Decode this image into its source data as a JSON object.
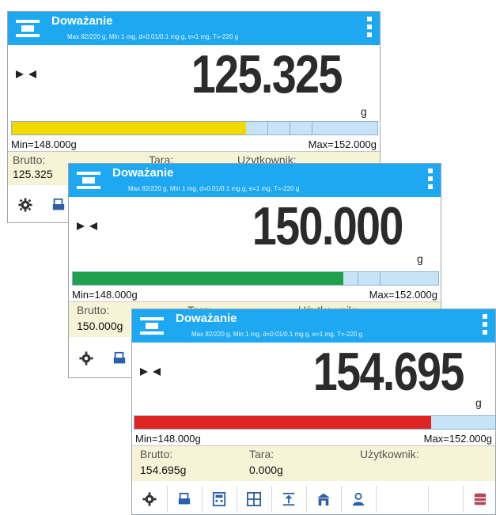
{
  "screens": [
    {
      "title": "Doważanie",
      "info": "Max 82/220 g, Min 1 mg, d=0.01/0.1 mg g, e=1 mg, T=-220 g",
      "reading": "125.325",
      "unit": "g",
      "bar": {
        "fill_fraction": 0.64,
        "fill_color": "#f2d900"
      },
      "min_label": "Min=148.000g",
      "max_label": "Max=152.000g",
      "gross_label": "Brutto:",
      "gross_value": "125.325",
      "tare_label": "Tara:",
      "user_label": "Użytkownik:"
    },
    {
      "title": "Doważanie",
      "info": "Max 82/220 g, Min 1 mg, d=0.01/0.1 mg g, e=1 mg, T=-220 g",
      "reading": "150.000",
      "unit": "g",
      "bar": {
        "fill_fraction": 0.74,
        "fill_color": "#1fa14a"
      },
      "min_label": "Min=148.000g",
      "max_label": "Max=152.000g",
      "gross_label": "Brutto:",
      "gross_value": "150.000g",
      "tare_label": "Tara:",
      "user_label": "Użytkownik:"
    },
    {
      "title": "Doważanie",
      "info": "Max 82/220 g, Min 1 mg, d=0.01/0.1 mg g, e=1 mg, T=-220 g",
      "reading": "154.695",
      "unit": "g",
      "bar": {
        "fill_fraction": 0.82,
        "fill_color": "#e02424"
      },
      "min_label": "Min=148.000g",
      "max_label": "Max=152.000g",
      "gross_label": "Brutto:",
      "gross_value": "154.695g",
      "tare_label": "Tara:",
      "tare_value": "0.000g",
      "user_label": "Użytkownik:"
    }
  ],
  "toolbar_icons": [
    "gear-icon",
    "printer-icon",
    "calculator-icon",
    "weight-table-icon",
    "upload-icon",
    "warehouse-icon",
    "user-icon",
    "database-icon"
  ]
}
